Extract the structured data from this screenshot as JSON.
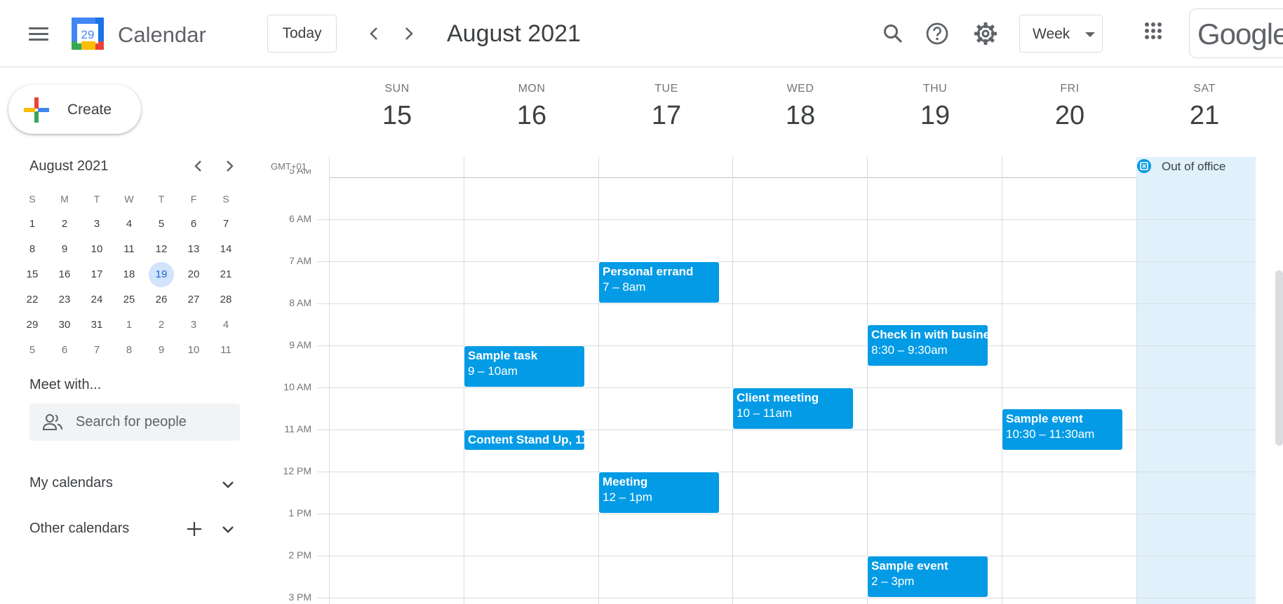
{
  "header": {
    "app_title": "Calendar",
    "logo_day": "29",
    "today_label": "Today",
    "period_title": "August 2021",
    "view_label": "Week",
    "brand": "Google"
  },
  "sidebar": {
    "create_label": "Create",
    "mini_calendar": {
      "title": "August 2021",
      "weekdays": [
        "S",
        "M",
        "T",
        "W",
        "T",
        "F",
        "S"
      ],
      "weeks": [
        [
          "1",
          "2",
          "3",
          "4",
          "5",
          "6",
          "7"
        ],
        [
          "8",
          "9",
          "10",
          "11",
          "12",
          "13",
          "14"
        ],
        [
          "15",
          "16",
          "17",
          "18",
          "19",
          "20",
          "21"
        ],
        [
          "22",
          "23",
          "24",
          "25",
          "26",
          "27",
          "28"
        ],
        [
          "29",
          "30",
          "31",
          "1",
          "2",
          "3",
          "4"
        ],
        [
          "5",
          "6",
          "7",
          "8",
          "9",
          "10",
          "11"
        ]
      ],
      "today": "19"
    },
    "meet_with": "Meet with...",
    "people_placeholder": "Search for people",
    "my_calendars": "My calendars",
    "other_calendars": "Other calendars"
  },
  "week": {
    "timezone": "GMT+01",
    "days": [
      {
        "dow": "SUN",
        "date": "15"
      },
      {
        "dow": "MON",
        "date": "16"
      },
      {
        "dow": "TUE",
        "date": "17"
      },
      {
        "dow": "WED",
        "date": "18"
      },
      {
        "dow": "THU",
        "date": "19"
      },
      {
        "dow": "FRI",
        "date": "20"
      },
      {
        "dow": "SAT",
        "date": "21"
      }
    ],
    "hours": [
      "5 AM",
      "6 AM",
      "7 AM",
      "8 AM",
      "9 AM",
      "10 AM",
      "11 AM",
      "12 PM",
      "1 PM",
      "2 PM",
      "3 PM"
    ],
    "all_day_event": {
      "title": "Out of office",
      "day": 6
    },
    "events": [
      {
        "title": "Personal errand",
        "time": "7 – 8am",
        "day": 2,
        "start": 7,
        "end": 8
      },
      {
        "title": "Sample task",
        "time": "9 – 10am",
        "day": 1,
        "start": 9,
        "end": 10
      },
      {
        "title": "Content Stand Up, 11",
        "time": "",
        "day": 1,
        "start": 11,
        "end": 11.5
      },
      {
        "title": "Check in with busine",
        "time": "8:30 – 9:30am",
        "day": 4,
        "start": 8.5,
        "end": 9.5
      },
      {
        "title": "Client meeting",
        "time": "10 – 11am",
        "day": 3,
        "start": 10,
        "end": 11
      },
      {
        "title": "Sample event",
        "time": "10:30 – 11:30am",
        "day": 5,
        "start": 10.5,
        "end": 11.5
      },
      {
        "title": "Meeting",
        "time": "12 – 1pm",
        "day": 2,
        "start": 12,
        "end": 13
      },
      {
        "title": "Sample event",
        "time": "2 – 3pm",
        "day": 4,
        "start": 14,
        "end": 15
      }
    ]
  },
  "colors": {
    "event": "#039be5",
    "today_highlight": "#d2e3fc",
    "out_of_office_bg": "#e1f1fc"
  }
}
